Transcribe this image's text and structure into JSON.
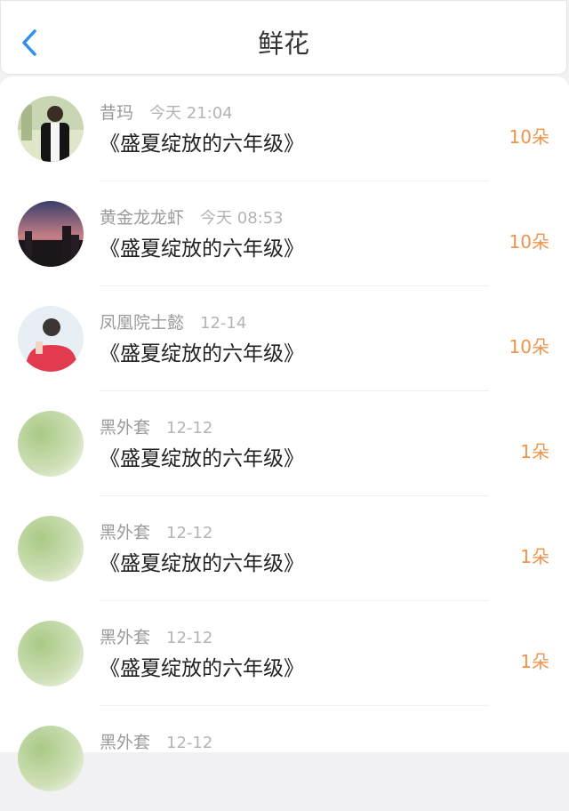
{
  "header": {
    "title": "鲜花",
    "back_icon": "chevron-left-icon",
    "accent_color": "#2f8ff0"
  },
  "colors": {
    "count": "#f0944a",
    "meta": "#9a9a9a"
  },
  "items": [
    {
      "name": "昔玛",
      "time": "今天 21:04",
      "book": "《盛夏绽放的六年级》",
      "count": "10朵",
      "avatar": "avatar-photo-boy"
    },
    {
      "name": "黄金龙龙虾",
      "time": "今天 08:53",
      "book": "《盛夏绽放的六年级》",
      "count": "10朵",
      "avatar": "avatar-photo-sunset"
    },
    {
      "name": "凤凰院士懿",
      "time": "12-14",
      "book": "《盛夏绽放的六年级》",
      "count": "10朵",
      "avatar": "avatar-photo-person"
    },
    {
      "name": "黑外套",
      "time": "12-12",
      "book": "《盛夏绽放的六年级》",
      "count": "1朵",
      "avatar": "avatar-default-green"
    },
    {
      "name": "黑外套",
      "time": "12-12",
      "book": "《盛夏绽放的六年级》",
      "count": "1朵",
      "avatar": "avatar-default-green"
    },
    {
      "name": "黑外套",
      "time": "12-12",
      "book": "《盛夏绽放的六年级》",
      "count": "1朵",
      "avatar": "avatar-default-green"
    },
    {
      "name": "黑外套",
      "time": "12-12",
      "book": "",
      "count": "",
      "avatar": "avatar-default-green"
    }
  ]
}
